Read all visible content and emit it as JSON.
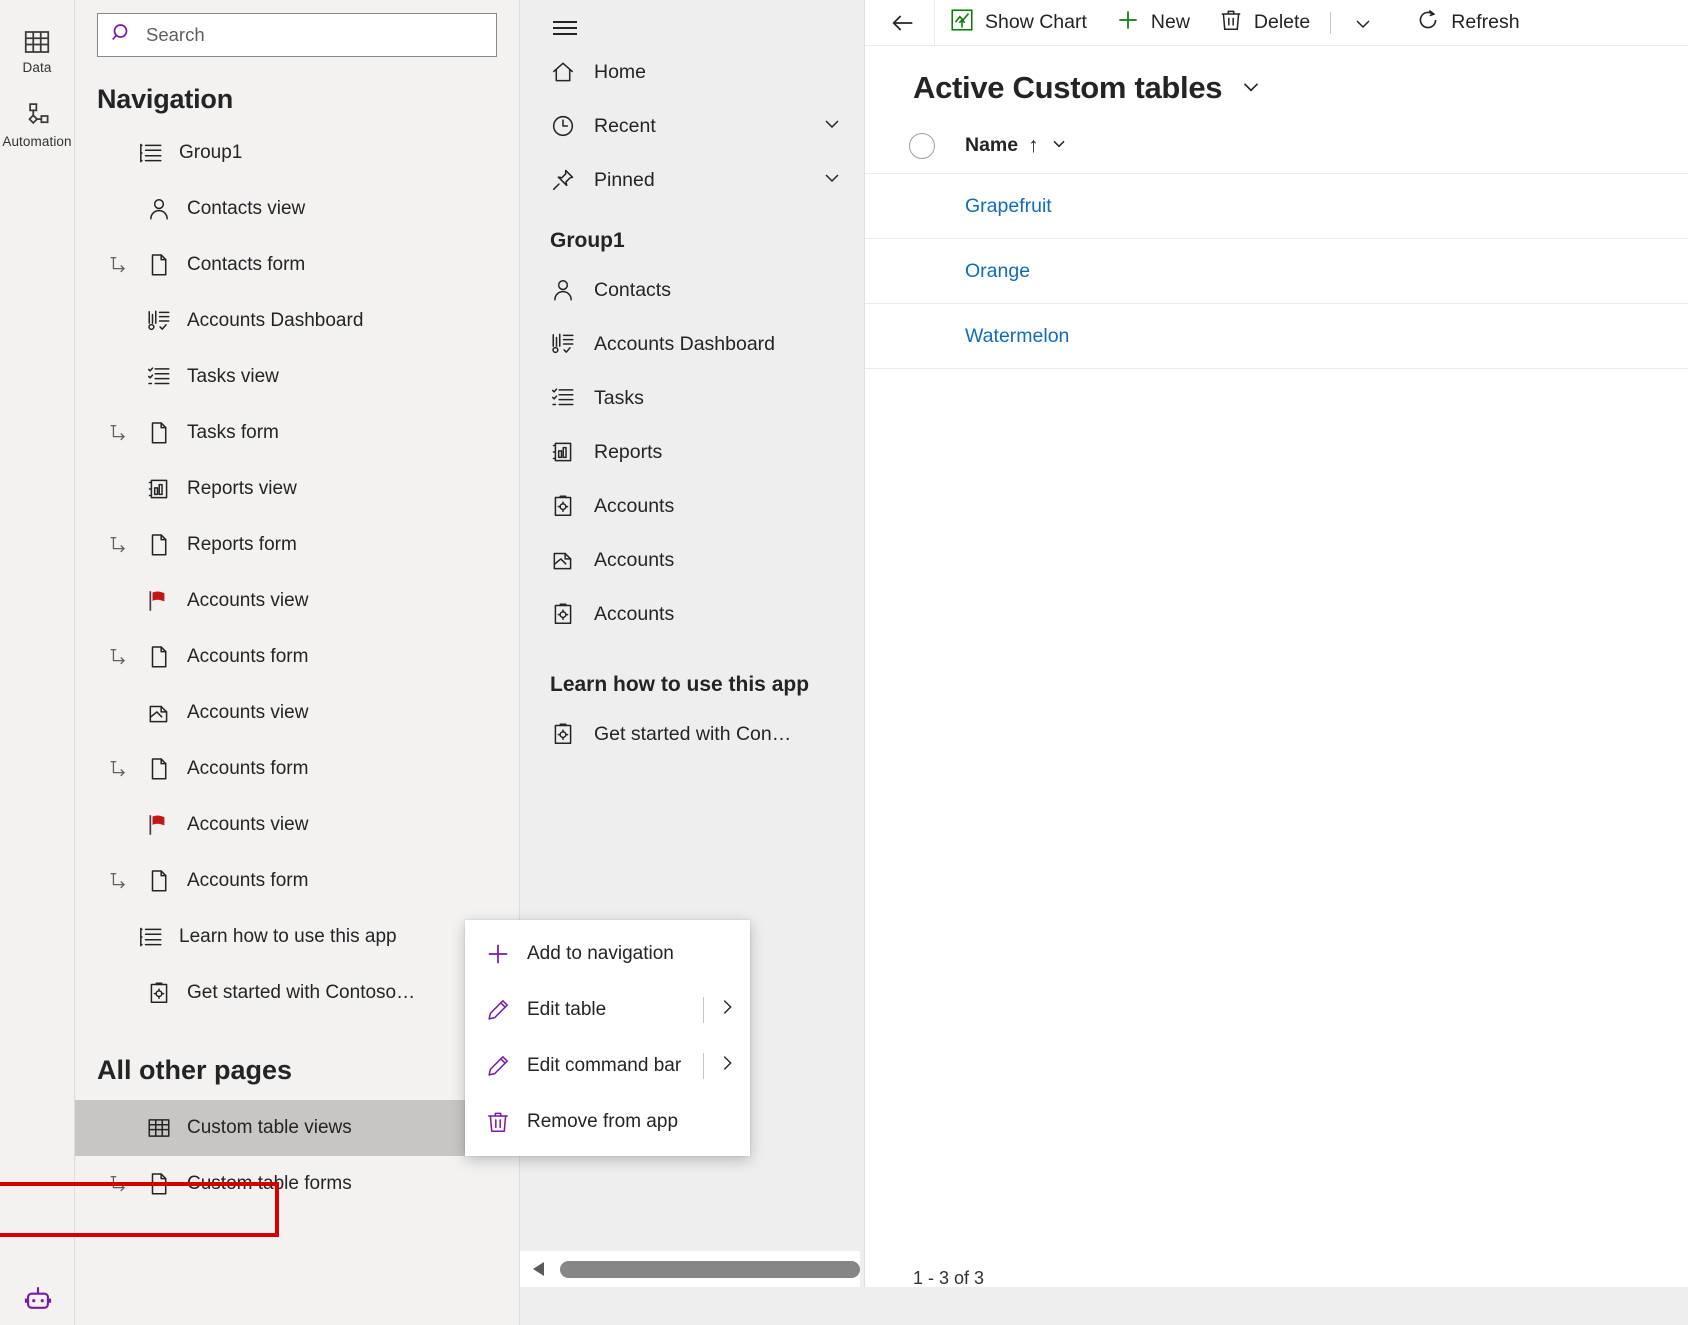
{
  "rail": {
    "items": [
      {
        "label": "Data",
        "icon": "table-icon"
      },
      {
        "label": "Automation",
        "icon": "automation-icon"
      }
    ],
    "bottom_icon": "copilot-robot-icon"
  },
  "search": {
    "placeholder": "Search",
    "value": "",
    "icon": "search-icon"
  },
  "navigation": {
    "title": "Navigation",
    "items": [
      {
        "label": "Group1",
        "icon": "group-list-icon",
        "indent": 0,
        "indicator": ""
      },
      {
        "label": "Contacts view",
        "icon": "contact-icon",
        "indent": 1,
        "indicator": ""
      },
      {
        "label": "Contacts form",
        "icon": "form-page-icon",
        "indent": 1,
        "indicator": "subitem-arrow-icon"
      },
      {
        "label": "Accounts Dashboard",
        "icon": "dashboard-icon",
        "indent": 1,
        "indicator": ""
      },
      {
        "label": "Tasks view",
        "icon": "task-list-icon",
        "indent": 1,
        "indicator": ""
      },
      {
        "label": "Tasks form",
        "icon": "form-page-icon",
        "indent": 1,
        "indicator": "subitem-arrow-icon"
      },
      {
        "label": "Reports view",
        "icon": "report-chart-icon",
        "indent": 1,
        "indicator": ""
      },
      {
        "label": "Reports form",
        "icon": "form-page-icon",
        "indent": 1,
        "indicator": "subitem-arrow-icon"
      },
      {
        "label": "Accounts view",
        "icon": "red-flag-icon",
        "indent": 1,
        "indicator": ""
      },
      {
        "label": "Accounts form",
        "icon": "form-page-icon",
        "indent": 1,
        "indicator": "subitem-arrow-icon"
      },
      {
        "label": "Accounts view",
        "icon": "card-shuffle-icon",
        "indent": 1,
        "indicator": ""
      },
      {
        "label": "Accounts form",
        "icon": "form-page-icon",
        "indent": 1,
        "indicator": "subitem-arrow-icon"
      },
      {
        "label": "Accounts view",
        "icon": "red-flag-icon",
        "indent": 1,
        "indicator": ""
      },
      {
        "label": "Accounts form",
        "icon": "form-page-icon",
        "indent": 1,
        "indicator": "subitem-arrow-icon"
      },
      {
        "label": "Learn how to use this app",
        "icon": "group-list-icon",
        "indent": 0,
        "indicator": ""
      },
      {
        "label": "Get started with Contoso…",
        "icon": "clipboard-gear-icon",
        "indent": 1,
        "indicator": ""
      }
    ],
    "all_other_pages_heading": "All other pages",
    "other_pages": [
      {
        "label": "Custom table views",
        "icon": "table-grid-icon",
        "indent": 1,
        "selected": true,
        "indicator": "",
        "more": "…"
      },
      {
        "label": "Custom table forms",
        "icon": "form-page-icon",
        "indent": 1,
        "selected": false,
        "indicator": "subitem-arrow-icon",
        "more": ""
      }
    ]
  },
  "context_menu": {
    "highlight_color": "#d40000",
    "items": [
      {
        "label": "Add to navigation",
        "icon": "plus-icon",
        "has_submenu": false,
        "highlighted": false
      },
      {
        "label": "Edit table",
        "icon": "pencil-icon",
        "has_submenu": true,
        "highlighted": false
      },
      {
        "label": "Edit command bar",
        "icon": "pencil-icon",
        "has_submenu": true,
        "highlighted": false
      },
      {
        "label": "Remove from app",
        "icon": "trash-icon",
        "has_submenu": false,
        "highlighted": true
      }
    ]
  },
  "preview": {
    "hamburger_icon": "hamburger-icon",
    "top_items": [
      {
        "label": "Home",
        "icon": "home-icon",
        "chevron": false
      },
      {
        "label": "Recent",
        "icon": "clock-icon",
        "chevron": true
      },
      {
        "label": "Pinned",
        "icon": "pin-icon",
        "chevron": true
      }
    ],
    "group_heading": "Group1",
    "group_items": [
      {
        "label": "Contacts",
        "icon": "contact-icon"
      },
      {
        "label": "Accounts Dashboard",
        "icon": "dashboard-icon"
      },
      {
        "label": "Tasks",
        "icon": "task-list-icon"
      },
      {
        "label": "Reports",
        "icon": "report-chart-icon"
      },
      {
        "label": "Accounts",
        "icon": "clipboard-gear-icon"
      },
      {
        "label": "Accounts",
        "icon": "card-shuffle-icon"
      },
      {
        "label": "Accounts",
        "icon": "clipboard-gear-icon"
      }
    ],
    "learn_heading": "Learn how to use this app",
    "learn_items": [
      {
        "label": "Get started with Con…",
        "icon": "clipboard-gear-icon"
      }
    ]
  },
  "command_bar": {
    "back_icon": "back-arrow-icon",
    "buttons": [
      {
        "label": "Show Chart",
        "icon": "show-chart-icon",
        "accent": "#107c10"
      },
      {
        "label": "New",
        "icon": "plus-icon",
        "accent": "#107c10"
      },
      {
        "label": "Delete",
        "icon": "trash-outline-icon",
        "accent": "#242424"
      }
    ],
    "overflow_icon": "chevron-down-icon",
    "refresh": {
      "label": "Refresh",
      "icon": "refresh-icon"
    }
  },
  "view": {
    "title": "Active Custom tables",
    "title_chevron_icon": "chevron-down-icon",
    "select_all_icon": "select-all-circle",
    "columns": [
      {
        "label": "Name",
        "sort": "↑",
        "chevron_icon": "chevron-down-icon"
      }
    ],
    "rows": [
      {
        "name": "Grapefruit"
      },
      {
        "name": "Orange"
      },
      {
        "name": "Watermelon"
      }
    ],
    "record_count": "1 - 3 of 3",
    "link_color": "#0f6cbd"
  },
  "scrollbar": {
    "left_arrow_icon": "triangle-left-icon"
  }
}
